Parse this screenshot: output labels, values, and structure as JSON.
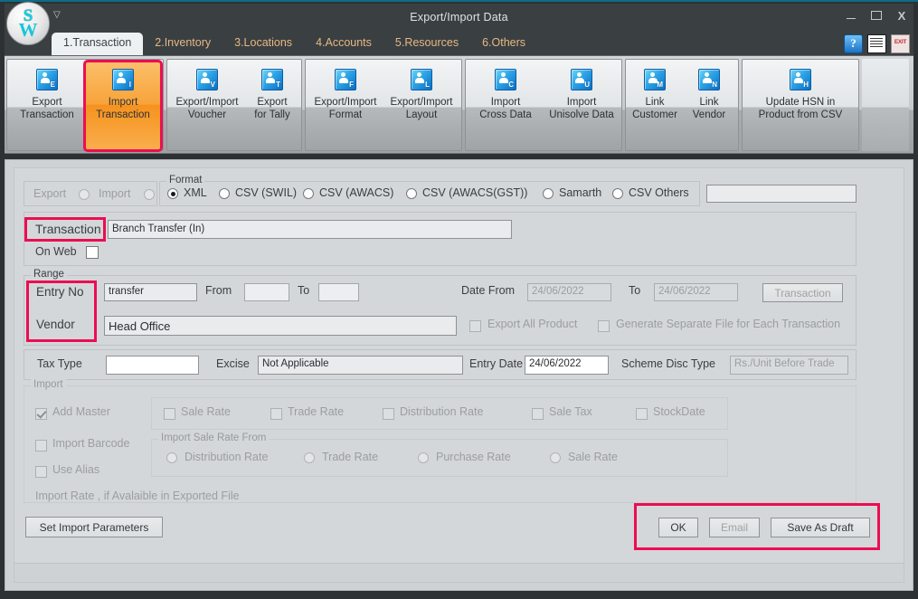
{
  "window": {
    "title": "Export/Import Data",
    "quick_access_icon": "chevron-down-icon",
    "minimize": "minimize-icon",
    "maximize": "maximize-icon",
    "close": "X"
  },
  "logo": {
    "top_letter": "S",
    "bottom_letter": "W"
  },
  "tabs": [
    {
      "label": "1.Transaction",
      "active": true
    },
    {
      "label": "2.Inventory",
      "active": false
    },
    {
      "label": "3.Locations",
      "active": false
    },
    {
      "label": "4.Accounts",
      "active": false
    },
    {
      "label": "5.Resources",
      "active": false
    },
    {
      "label": "6.Others",
      "active": false
    }
  ],
  "tab_icons": [
    {
      "name": "help-icon",
      "glyph": "?"
    },
    {
      "name": "document-icon",
      "glyph": ""
    },
    {
      "name": "exit-icon",
      "glyph": "EXIT"
    }
  ],
  "ribbon": {
    "groups": [
      {
        "buttons": [
          {
            "label_line1": "Export",
            "label_line2": "Transaction",
            "icon_letter": "E",
            "selected": false,
            "highlight": false
          },
          {
            "label_line1": "Import",
            "label_line2": "Transaction",
            "icon_letter": "I",
            "selected": true,
            "highlight": true
          }
        ]
      },
      {
        "buttons": [
          {
            "label_line1": "Export/Import",
            "label_line2": "Voucher",
            "icon_letter": "V",
            "selected": false,
            "highlight": false
          },
          {
            "label_line1": "Export",
            "label_line2": "for Tally",
            "icon_letter": "T",
            "selected": false,
            "highlight": false
          }
        ]
      },
      {
        "buttons": [
          {
            "label_line1": "Export/Import",
            "label_line2": "Format",
            "icon_letter": "F",
            "selected": false,
            "highlight": false
          },
          {
            "label_line1": "Export/Import",
            "label_line2": "Layout",
            "icon_letter": "L",
            "selected": false,
            "highlight": false
          }
        ]
      },
      {
        "buttons": [
          {
            "label_line1": "Import",
            "label_line2": "Cross Data",
            "icon_letter": "C",
            "selected": false,
            "highlight": false
          },
          {
            "label_line1": "Import",
            "label_line2": "Unisolve Data",
            "icon_letter": "U",
            "selected": false,
            "highlight": false
          }
        ]
      },
      {
        "buttons": [
          {
            "label_line1": "Link",
            "label_line2": "Customer",
            "icon_letter": "M",
            "selected": false,
            "highlight": false
          },
          {
            "label_line1": "Link",
            "label_line2": "Vendor",
            "icon_letter": "N",
            "selected": false,
            "highlight": false
          }
        ]
      },
      {
        "buttons": [
          {
            "label_line1": "Update HSN in",
            "label_line2": "Product from CSV",
            "icon_letter": "H",
            "selected": false,
            "highlight": false
          }
        ]
      }
    ]
  },
  "mode": {
    "export_label": "Export",
    "import_label": "Import",
    "export_selected": false,
    "import_selected": false
  },
  "format": {
    "legend": "Format",
    "options": [
      {
        "label": "XML",
        "selected": true
      },
      {
        "label": "CSV (SWIL)",
        "selected": false
      },
      {
        "label": "CSV (AWACS)",
        "selected": false
      },
      {
        "label": "CSV (AWACS(GST))",
        "selected": false
      },
      {
        "label": "Samarth",
        "selected": false
      },
      {
        "label": "CSV Others",
        "selected": false
      }
    ],
    "extra_combo_value": ""
  },
  "transaction": {
    "label": "Transaction",
    "value": "Branch Transfer (In)",
    "on_web_label": "On Web",
    "on_web_checked": false
  },
  "range": {
    "legend": "Range",
    "entry_no_label": "Entry No",
    "entry_no_combo": "transfer",
    "from_label": "From",
    "from_value": "",
    "to_label": "To",
    "to_value": "",
    "date_from_label": "Date From",
    "date_from_value": "24/06/2022",
    "date_to_label": "To",
    "date_to_value": "24/06/2022",
    "transaction_button": "Transaction",
    "vendor_label": "Vendor",
    "vendor_value": "Head Office",
    "export_all_product_label": "Export All Product",
    "export_all_product_checked": false,
    "generate_separate_label": "Generate Separate File for Each Transaction",
    "generate_separate_checked": false
  },
  "tax_row": {
    "tax_type_label": "Tax Type",
    "tax_type_value": "",
    "excise_label": "Excise",
    "excise_value": "Not Applicable",
    "entry_date_label": "Entry Date",
    "entry_date_value": "24/06/2022",
    "scheme_disc_label": "Scheme Disc Type",
    "scheme_disc_value": "Rs./Unit Before Trade"
  },
  "import_section": {
    "legend": "Import",
    "add_master_label": "Add Master",
    "add_master_checked": true,
    "rate_options": [
      {
        "label": "Sale Rate",
        "checked": false
      },
      {
        "label": "Trade Rate",
        "checked": false
      },
      {
        "label": "Distribution Rate",
        "checked": false
      },
      {
        "label": "Sale Tax",
        "checked": false
      },
      {
        "label": "StockDate",
        "checked": false
      }
    ],
    "import_barcode_label": "Import Barcode",
    "import_barcode_checked": false,
    "use_alias_label": "Use Alias",
    "use_alias_checked": false,
    "sale_rate_from_legend": "Import Sale Rate From",
    "sale_rate_from_options": [
      {
        "label": "Distribution Rate",
        "selected": false
      },
      {
        "label": "Trade Rate",
        "selected": false
      },
      {
        "label": "Purchase Rate",
        "selected": false
      },
      {
        "label": "Sale Rate",
        "selected": false
      }
    ],
    "note": "Import Rate , if Avalaible in Exported File"
  },
  "footer": {
    "set_import_parameters": "Set Import Parameters",
    "ok": "OK",
    "email": "Email",
    "save_as_draft": "Save As Draft"
  },
  "colors": {
    "highlight_red": "#ec0d52",
    "selected_orange": "#f6921e",
    "tab_text": "#e8b882",
    "panel_gray": "#d4d7d9"
  }
}
